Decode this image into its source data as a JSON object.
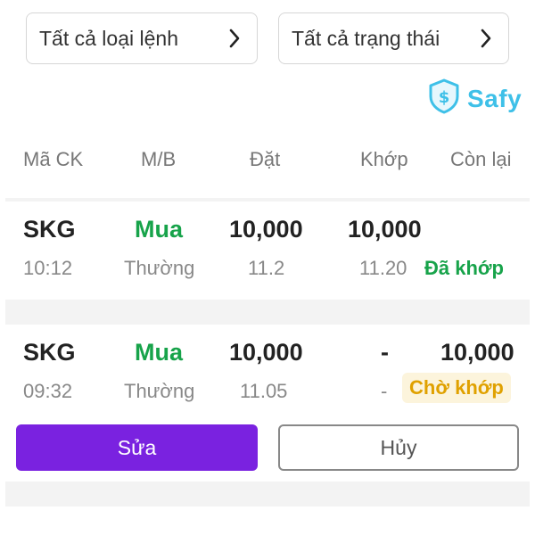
{
  "filters": {
    "order_type": "Tất cả loại lệnh",
    "status": "Tất cả trạng thái"
  },
  "logo": {
    "name": "Safy",
    "icon": "shield-dollar-icon",
    "color": "#3ec0e8"
  },
  "columns": {
    "symbol": "Mã CK",
    "side": "M/B",
    "placed": "Đặt",
    "matched": "Khớp",
    "remaining": "Còn lại"
  },
  "orders": [
    {
      "symbol": "SKG",
      "time": "10:12",
      "side": "Mua",
      "order_type": "Thường",
      "placed_qty": "10,000",
      "placed_price": "11.2",
      "matched_qty": "10,000",
      "matched_price": "11.20",
      "remaining": "",
      "status": "Đã khớp"
    },
    {
      "symbol": "SKG",
      "time": "09:32",
      "side": "Mua",
      "order_type": "Thường",
      "placed_qty": "10,000",
      "placed_price": "11.05",
      "matched_qty": "-",
      "matched_price": "-",
      "remaining": "10,000",
      "status": "Chờ khớp"
    }
  ],
  "actions": {
    "edit": "Sửa",
    "cancel": "Hủy"
  },
  "colors": {
    "buy": "#17a34a",
    "pending": "#e0a100",
    "primary": "#7a22e0"
  }
}
